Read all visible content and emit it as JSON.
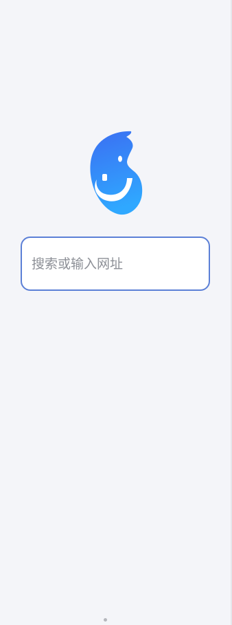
{
  "search": {
    "placeholder": "搜索或输入网址",
    "value": ""
  },
  "logo": {
    "icon": "app-logo-icon",
    "colors": {
      "gradient_top": "#3b6ff2",
      "gradient_bottom": "#2fa8ff",
      "accent": "#5b7fd6"
    }
  },
  "pager": {
    "current": 1
  }
}
